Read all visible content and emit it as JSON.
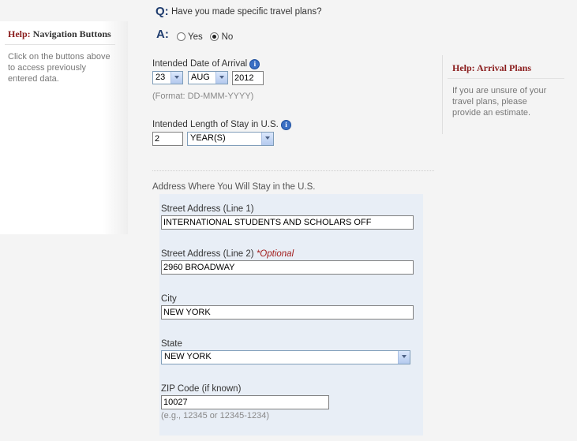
{
  "help_nav": {
    "label": "Help:",
    "title": "Navigation Buttons",
    "text": "Click on the buttons above to access previously entered data."
  },
  "question": {
    "q_marker": "Q:",
    "q_text": "Have you made specific travel plans?",
    "a_marker": "A:",
    "yes_label": "Yes",
    "no_label": "No",
    "selected": "No"
  },
  "arrival": {
    "label": "Intended Date of Arrival",
    "day": "23",
    "month": "AUG",
    "year": "2012",
    "format_hint": "(Format: DD-MMM-YYYY)"
  },
  "stay": {
    "label": "Intended Length of Stay in U.S.",
    "value": "2",
    "unit": "YEAR(S)"
  },
  "address": {
    "section_label": "Address Where You Will Stay in the U.S.",
    "street1_label": "Street Address (Line 1)",
    "street1_value": "INTERNATIONAL STUDENTS AND SCHOLARS OFF",
    "street2_label": "Street Address (Line 2)",
    "street2_optional": "*Optional",
    "street2_value": "2960 BROADWAY",
    "city_label": "City",
    "city_value": "NEW YORK",
    "state_label": "State",
    "state_value": "NEW YORK",
    "zip_label": "ZIP Code (if known)",
    "zip_value": "10027",
    "zip_hint": "(e.g., 12345 or 12345-1234)"
  },
  "help_arrival": {
    "label": "Help:",
    "title": "Arrival Plans",
    "text": "If you are unsure of your travel plans, please provide an estimate."
  },
  "colors": {
    "help_label": "#8a1c1c",
    "marker": "#1f3c6e",
    "optional": "#a11d1d"
  }
}
